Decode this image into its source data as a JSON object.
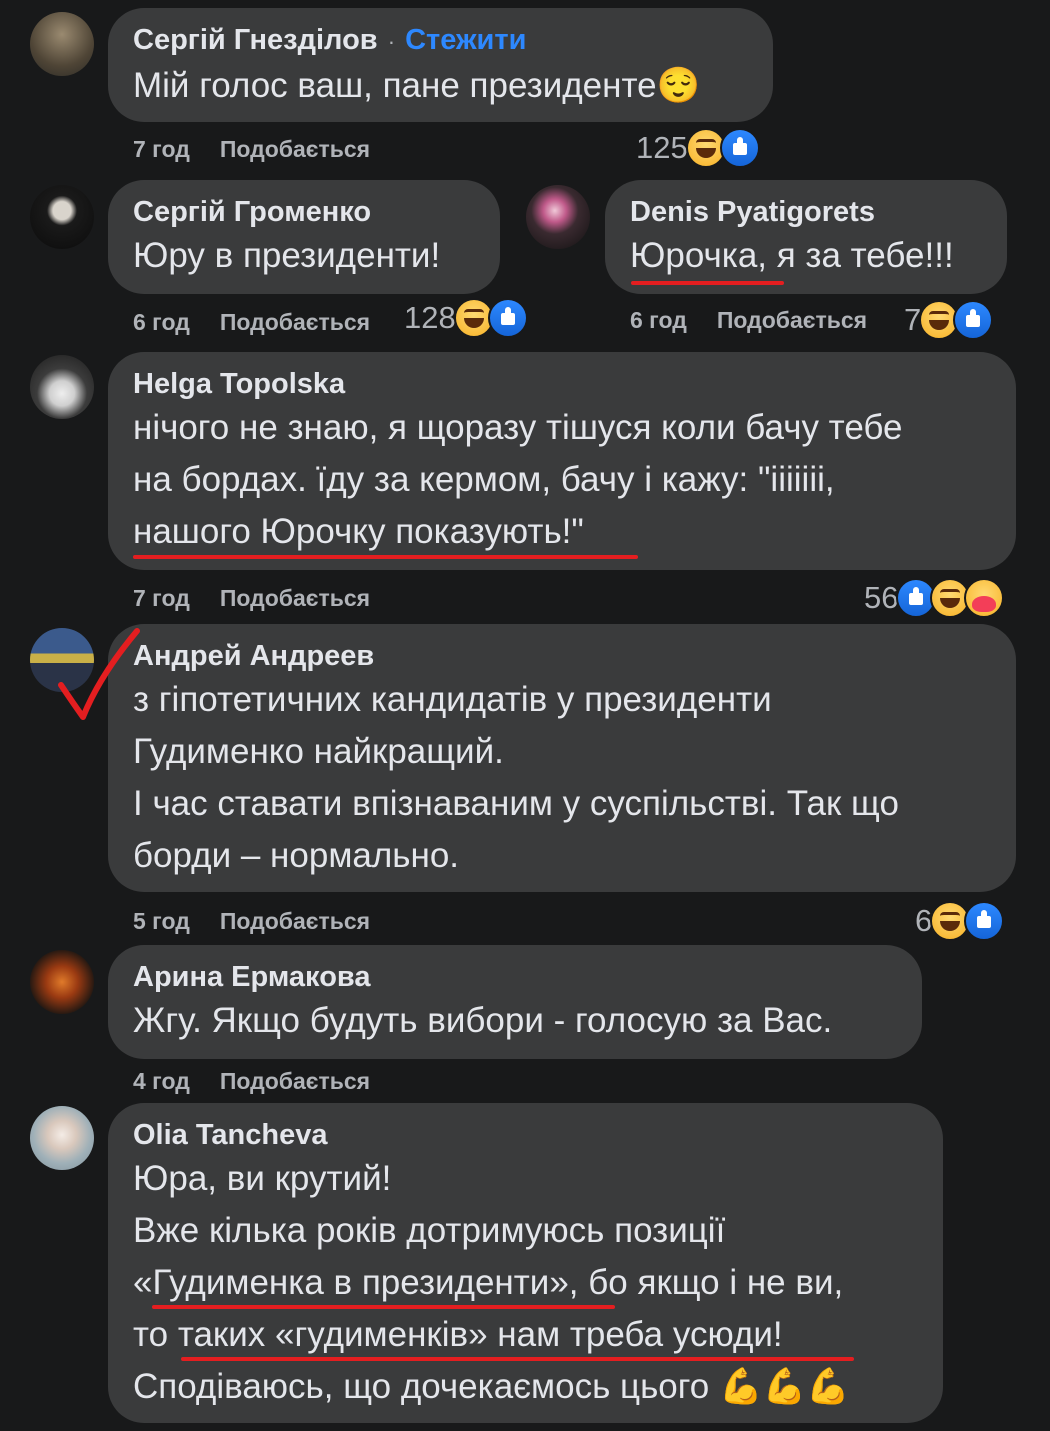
{
  "comments": [
    {
      "author": "Сергій Гнезділов",
      "dot": "·",
      "follow": "Стежити",
      "lines": [
        "Мій голос ваш, пане президенте😌"
      ],
      "time": "7 год",
      "like": "Подобається",
      "reactions": "125"
    },
    {
      "author": "Сергій Громенко",
      "lines": [
        "Юру в президенти!"
      ],
      "time": "6 год",
      "like": "Подобається",
      "reactions": "128"
    },
    {
      "author": "Denis Pyatigorets",
      "lines": [
        "Юрочка, я за тебе!!!"
      ],
      "time": "6 год",
      "like": "Подобається",
      "reactions": "7"
    },
    {
      "author": "Helga Topolska",
      "lines": [
        "нічого не знаю, я щоразу тішуся коли бачу тебе",
        "на бордах. їду за кермом, бачу і кажу: \"ііііііі,",
        "нашого Юрочку показують!\""
      ],
      "time": "7 год",
      "like": "Подобається",
      "reactions": "56"
    },
    {
      "author": "Андрей Андреев",
      "lines": [
        "з гіпотетичних кандидатів у президенти",
        "Гудименко найкращий.",
        "І час ставати впізнаваним у суспільстві. Так що",
        "борди – нормально."
      ],
      "time": "5 год",
      "like": "Подобається",
      "reactions": "6"
    },
    {
      "author": "Арина Ермакова",
      "lines": [
        "Жгу. Якщо будуть вибори - голосую за Вас."
      ],
      "time": "4 год",
      "like": "Подобається"
    },
    {
      "author": "Olia Tancheva",
      "lines": [
        "Юра, ви крутий!",
        "Вже кілька років дотримуюсь позиції",
        "«Гудименка в президенти», бо якщо і не ви,",
        "то таких «гудименків» нам треба усюди!",
        "Сподіваюсь, що дочекаємось цього 💪💪💪"
      ]
    }
  ],
  "colors": {
    "background": "#18191a",
    "bubble": "#3a3b3c",
    "link": "#2d88ff",
    "annotation": "#e41e20"
  }
}
